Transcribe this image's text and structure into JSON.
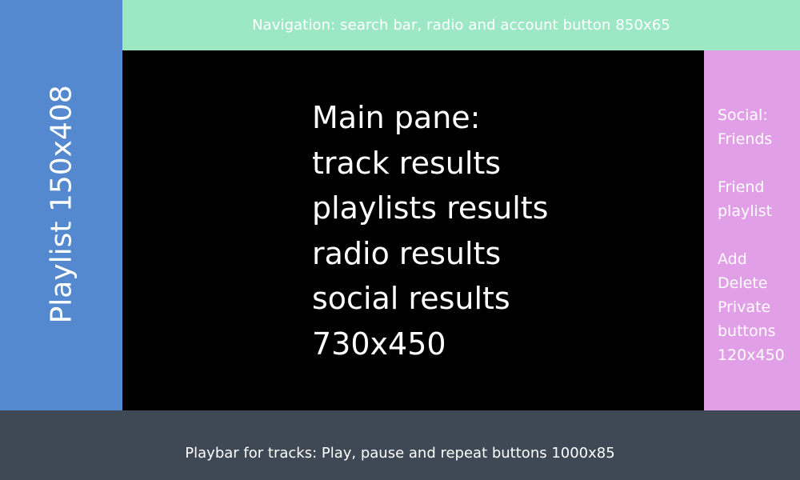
{
  "navigation": {
    "label": "Navigation: search bar, radio and account button 850x65",
    "color": "#9de8c4"
  },
  "playlist": {
    "label": "Playlist 150x408",
    "color": "#5488cf"
  },
  "main_pane": {
    "lines": [
      "Main pane:",
      "track results",
      "playlists results",
      "radio results",
      "social results",
      "730x450"
    ],
    "color": "#000000"
  },
  "social": {
    "lines": [
      "Social:",
      "Friends",
      "",
      "Friend",
      "playlist",
      "",
      "Add",
      "Delete",
      "Private",
      "buttons",
      "120x450"
    ],
    "color": "#e09fe6"
  },
  "playbar": {
    "label": "Playbar for tracks: Play, pause and repeat buttons 1000x85",
    "color": "#3e4955"
  }
}
